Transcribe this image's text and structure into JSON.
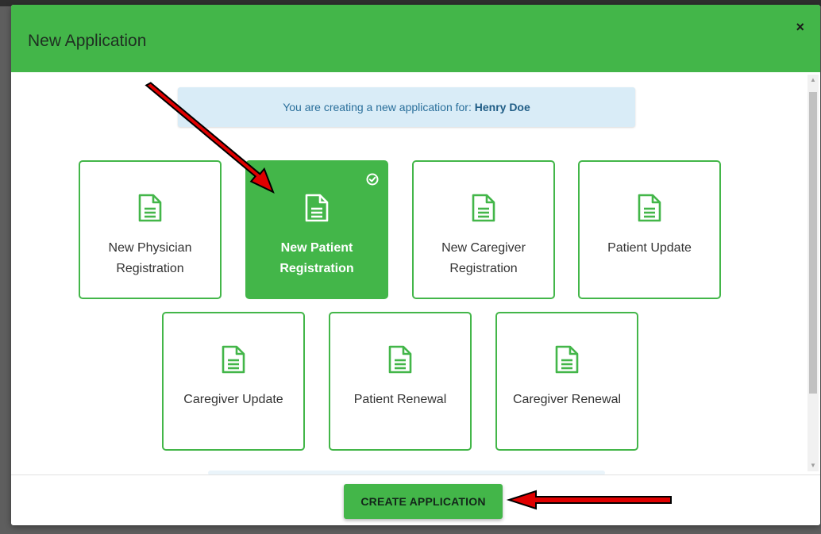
{
  "modal": {
    "title": "New Application",
    "close_label": "×"
  },
  "info": {
    "prefix": "You are creating a new application for: ",
    "name": "Henry Doe"
  },
  "tiles": [
    {
      "label": "New Physician Registration",
      "selected": false
    },
    {
      "label": "New Patient Registration",
      "selected": true
    },
    {
      "label": "New Caregiver Registration",
      "selected": false
    },
    {
      "label": "Patient Update",
      "selected": false
    },
    {
      "label": "Caregiver Update",
      "selected": false
    },
    {
      "label": "Patient Renewal",
      "selected": false
    },
    {
      "label": "Caregiver Renewal",
      "selected": false
    }
  ],
  "footer": {
    "create_label": "CREATE APPLICATION"
  },
  "icons": {
    "tile_icon": "document-icon",
    "selected_icon": "check-circle-icon",
    "annotation": "red-arrow"
  },
  "colors": {
    "accent": "#43b649",
    "info_bg": "#d9ecf7",
    "annotation": "#e00000"
  }
}
